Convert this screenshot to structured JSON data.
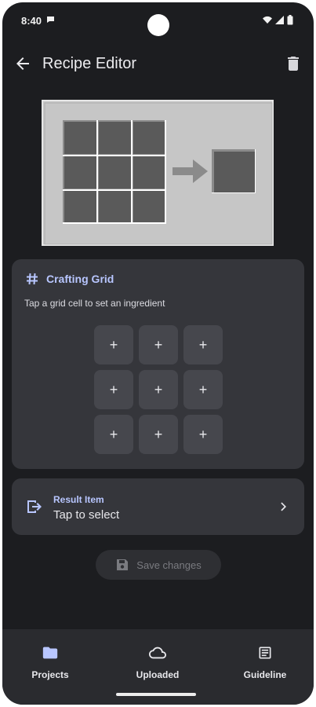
{
  "status_bar": {
    "time": "8:40"
  },
  "app_bar": {
    "title": "Recipe Editor"
  },
  "crafting_card": {
    "title": "Crafting Grid",
    "subtitle": "Tap a grid cell to set an ingredient",
    "cells": [
      "+",
      "+",
      "+",
      "+",
      "+",
      "+",
      "+",
      "+",
      "+"
    ]
  },
  "result": {
    "label": "Result Item",
    "value": "Tap to select"
  },
  "save_button": {
    "label": "Save changes"
  },
  "bottom_nav": [
    {
      "label": "Projects",
      "icon": "folder-icon"
    },
    {
      "label": "Uploaded",
      "icon": "cloud-icon"
    },
    {
      "label": "Guideline",
      "icon": "article-icon"
    }
  ],
  "colors": {
    "background": "#1c1d20",
    "card": "#35363b",
    "accent": "#b8c6ff",
    "nav": "#2a2b2f"
  }
}
